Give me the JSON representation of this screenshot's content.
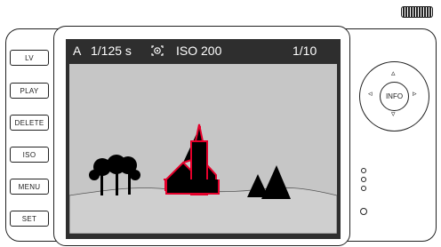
{
  "buttons": {
    "lv": "LV",
    "play": "PLAY",
    "delete": "DELETE",
    "iso": "ISO",
    "menu": "MENU",
    "set": "SET",
    "info": "INFO"
  },
  "display": {
    "mode": "A",
    "shutter": "1/125 s",
    "metering_icon": "metering-icon",
    "iso": "ISO 200",
    "counter": "1/10"
  },
  "icons": {
    "up": "▵",
    "down": "▿",
    "left": "◃",
    "right": "▹"
  },
  "colors": {
    "focus_highlight": "#e4002b",
    "screen_background": "#2e2e2e",
    "scene_background": "#c6c6c6"
  }
}
